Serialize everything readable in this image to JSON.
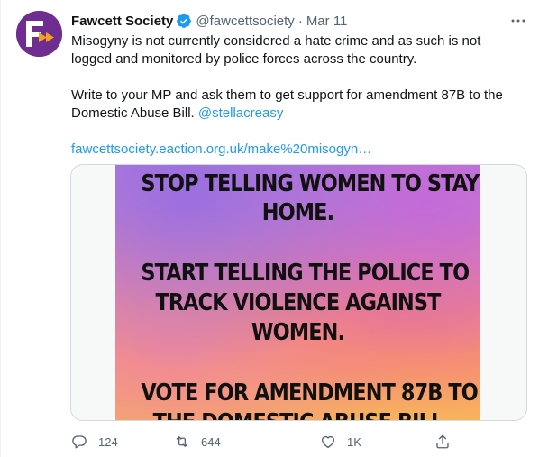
{
  "tweet": {
    "author_name": "Fawcett Society",
    "handle": "@fawcettsociety",
    "separator": "·",
    "date": "Mar 11",
    "more_icon": "more-horizontal-icon",
    "avatar_icon": "fawcett-logo",
    "verified_icon": "verified-badge-icon",
    "paragraph1": "Misogyny is not currently considered a hate crime and as such is not logged and monitored by police forces across the country.",
    "paragraph2_text": "Write to your MP and ask them to get support for amendment 87B to the Domestic Abuse Bill.",
    "mention": "@stellacreasy",
    "link": "fawcettsociety.eaction.org.uk/make%20misogyn…"
  },
  "media": {
    "lines": [
      "STOP TELLING WOMEN TO STAY",
      "HOME.",
      "START TELLING THE POLICE TO",
      "TRACK VIOLENCE AGAINST",
      "WOMEN.",
      "VOTE FOR AMENDMENT 87B TO",
      "THE DOMESTIC ABUSE BILL"
    ]
  },
  "actions": {
    "reply_count": "124",
    "retweet_count": "644",
    "like_count": "1K",
    "reply_icon": "reply-icon",
    "retweet_icon": "retweet-icon",
    "like_icon": "heart-icon",
    "share_icon": "share-icon"
  },
  "colors": {
    "accent": "#1d9bf0",
    "brand_purple": "#6f2c91",
    "brand_orange": "#f7a21b",
    "muted_text": "#536471"
  }
}
